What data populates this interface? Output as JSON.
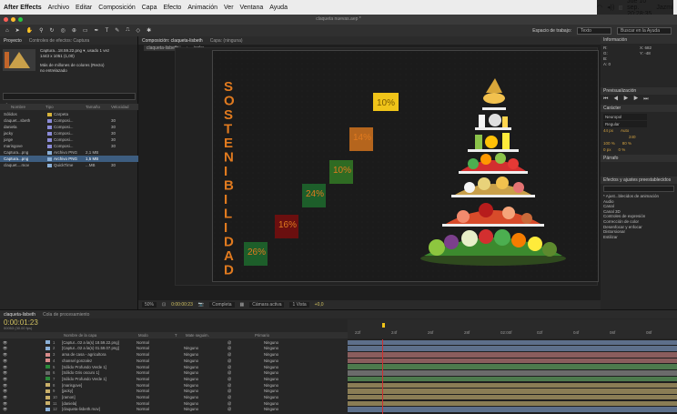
{
  "menubar": {
    "app": "After Effects",
    "items": [
      "Archivo",
      "Editar",
      "Composición",
      "Capa",
      "Efecto",
      "Animación",
      "Ver",
      "Ventana",
      "Ayuda"
    ],
    "clock": "Jue 10 sep. 20:28:35",
    "user": "Jazmí"
  },
  "window": {
    "title": "claqueta nuevas.aep *"
  },
  "toolbar": {
    "workspace_label": "Espacio de trabajo:",
    "workspace_value": "Texto",
    "help_placeholder": "Buscar en la Ayuda"
  },
  "project": {
    "tabs": [
      "Proyecto",
      "Controles de efectos: Captura"
    ],
    "selected_name": "Captura...18.59.22.png ▾, usado 1 vez",
    "selected_dims": "1443 x 1051 (1,00)",
    "selected_desc": "Más de millones de colores (Recto)",
    "selected_interp": "no entrelazado",
    "search_placeholder": "⌕",
    "columns": {
      "name": "Nombre",
      "type": "Tipo",
      "size": "Tamaño",
      "fps": "Velocidad"
    },
    "rows": [
      {
        "name": "Sólidos",
        "type": "Carpeta",
        "size": "",
        "fps": "",
        "color": "#d8b43a"
      },
      {
        "name": "claquet...sbeth",
        "type": "Composi...",
        "size": "",
        "fps": "30",
        "color": "#8b8bd8"
      },
      {
        "name": "daniela",
        "type": "Composi...",
        "size": "",
        "fps": "30",
        "color": "#8b8bd8"
      },
      {
        "name": "jacky",
        "type": "Composi...",
        "size": "",
        "fps": "30",
        "color": "#8b8bd8"
      },
      {
        "name": "jorge",
        "type": "Composi...",
        "size": "",
        "fps": "30",
        "color": "#8b8bd8"
      },
      {
        "name": "marisgove",
        "type": "Composi...",
        "size": "",
        "fps": "30",
        "color": "#8b8bd8"
      },
      {
        "name": "Captura...png",
        "type": "Archivo PNG",
        "size": "2,1 MB",
        "fps": "",
        "color": "#8bb0d8"
      },
      {
        "name": "Captura...png",
        "type": "Archivo PNG",
        "size": "1,5 MB",
        "fps": "",
        "color": "#8bb0d8"
      },
      {
        "name": "claquet....mov",
        "type": "QuickTime",
        "size": "...MB",
        "fps": "30",
        "color": "#8bb0d8"
      }
    ],
    "footer": "8 bpc"
  },
  "composition": {
    "tabs": [
      "Composición: claqueta-lisbeth",
      "Capa: (ninguna)"
    ],
    "breadcrumb": [
      "claqueta-lisbeth",
      "jacky"
    ],
    "zoom": "50%",
    "time": "0:00:00:23",
    "resolution": "Completa",
    "camera": "Cámara activa",
    "views": "1 Vista",
    "exposure": "+0,0"
  },
  "artwork": {
    "vertical_word": [
      "S",
      "O",
      "S",
      "T",
      "E",
      "N",
      "I",
      "B",
      "I",
      "L",
      "I",
      "D",
      "A",
      "D"
    ],
    "steps": [
      "26%",
      "16%",
      "24%",
      "10%",
      "14%",
      "10%"
    ],
    "step_colors": [
      "#1d5e2a",
      "#6a0f0f",
      "#1d5e2a",
      "#2f6b23",
      "#b5651d",
      "#f0c419"
    ]
  },
  "right_panel": {
    "info_title": "Información",
    "info_values": [
      "R:",
      "G:",
      "B:",
      "A: 0",
      "X: 682",
      "Y: -48"
    ],
    "preview_title": "Previsualización",
    "character_title": "Carácter",
    "font": "Neuropol",
    "style": "Regular",
    "size": "44 px",
    "leading": "Auto",
    "tracking": "240",
    "scale_v": "100 %",
    "scale_h": "80 %",
    "baseline": "0 px",
    "tsume": "0 %",
    "paragraph_title": "Párrafo",
    "effects_title": "Efectos y ajustes preestablecidos",
    "effects_list": [
      "* Ajust...blecidos de animación",
      "Audio",
      "Canal",
      "Canal 3D",
      "Controles de expresión",
      "Corrección de color",
      "Desenfocar y enfocar",
      "Distorsionar",
      "Estilizar"
    ]
  },
  "timeline": {
    "tabs": [
      "claqueta-lisbeth",
      "Cola de procesamiento"
    ],
    "timecode": "0:00:01:23",
    "frames": "00053 (30.00 fps)",
    "columns": [
      "Nombre de la capa",
      "Modo",
      "T",
      "Mate seguim.",
      "Primario"
    ],
    "ruler": [
      "22f",
      "24f",
      "26f",
      "28f",
      "02:00f",
      "02f",
      "04f",
      "06f",
      "08f"
    ],
    "layers": [
      {
        "num": "1",
        "name": "[Captur...02 a la(s) 18.59.22.png]",
        "mode": "Normal",
        "matte": "",
        "parent": "Ninguno",
        "color": "#8bb0d8"
      },
      {
        "num": "2",
        "name": "[Captur...02 a la(s) 01.59.07.png]",
        "mode": "Normal",
        "matte": "Ninguno",
        "parent": "Ninguno",
        "color": "#8bb0d8"
      },
      {
        "num": "3",
        "name": "ama de casa - agricultora",
        "mode": "Normal",
        "matte": "Ninguno",
        "parent": "Ninguno",
        "color": "#d88b8b"
      },
      {
        "num": "4",
        "name": "chansel gonzalez",
        "mode": "Normal",
        "matte": "Ninguno",
        "parent": "Ninguno",
        "color": "#d88b8b"
      },
      {
        "num": "5",
        "name": "[Sólido Profundo Verde 1]",
        "mode": "Normal",
        "matte": "Ninguno",
        "parent": "Ninguno",
        "color": "#2a8a3a"
      },
      {
        "num": "6",
        "name": "[Sólido Gris oscuro 1]",
        "mode": "Normal",
        "matte": "Ninguno",
        "parent": "Ninguno",
        "color": "#666"
      },
      {
        "num": "7",
        "name": "[Sólido Profundo Verde 1]",
        "mode": "Normal",
        "matte": "Ninguno",
        "parent": "Ninguno",
        "color": "#2a8a3a"
      },
      {
        "num": "8",
        "name": "[marisgove]",
        "mode": "Normal",
        "matte": "Ninguno",
        "parent": "Ninguno",
        "color": "#c9b06a"
      },
      {
        "num": "9",
        "name": "[jacky]",
        "mode": "Normal",
        "matte": "Ninguno",
        "parent": "Ninguno",
        "color": "#c9b06a"
      },
      {
        "num": "10",
        "name": "[ramon]",
        "mode": "Normal",
        "matte": "Ninguno",
        "parent": "Ninguno",
        "color": "#c9b06a"
      },
      {
        "num": "11",
        "name": "[daniela]",
        "mode": "Normal",
        "matte": "Ninguno",
        "parent": "Ninguno",
        "color": "#c9b06a"
      },
      {
        "num": "12",
        "name": "[claqueta-lisbeth.mov]",
        "mode": "Normal",
        "matte": "Ninguno",
        "parent": "Ninguno",
        "color": "#8bb0d8"
      }
    ],
    "bar_colors": [
      "#5d6f8a",
      "#5d6f8a",
      "#8a5d5d",
      "#8a5d5d",
      "#4d7a4d",
      "#6b6b6b",
      "#4d7a4d",
      "#8a7d55",
      "#8a7d55",
      "#8a7d55",
      "#8a7d55",
      "#5d6f8a"
    ]
  }
}
